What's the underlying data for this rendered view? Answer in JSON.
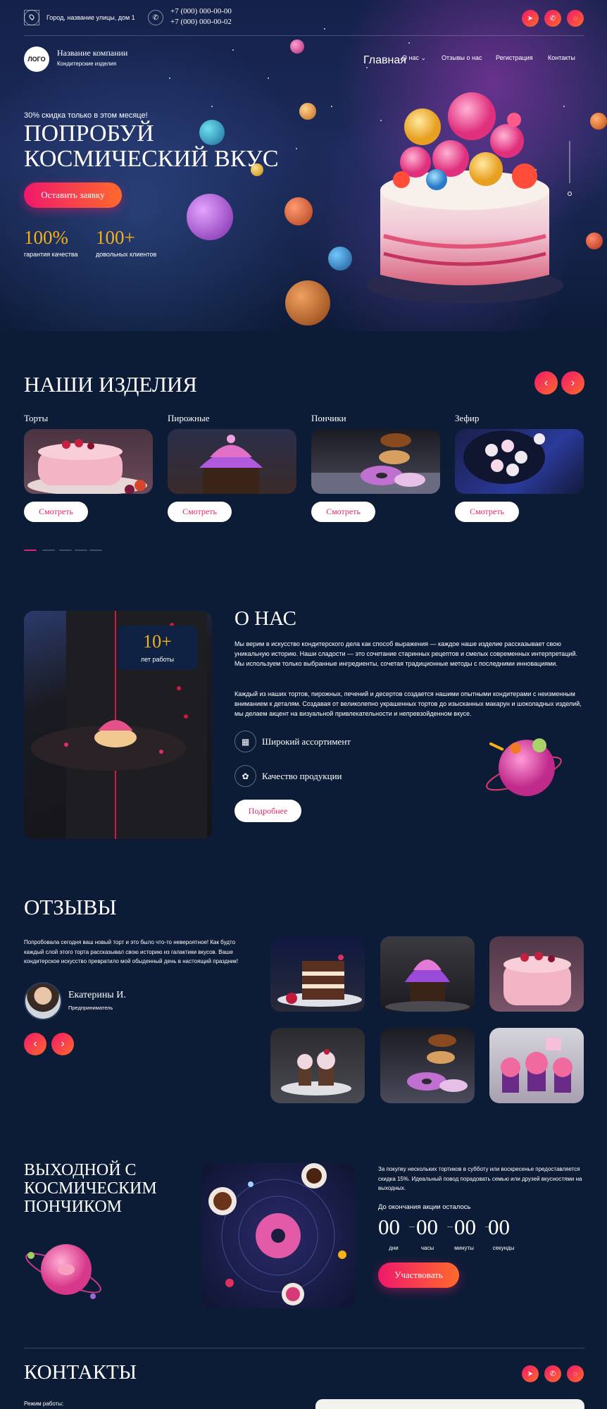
{
  "topbar": {
    "address": "Город, название улицы, дом 1",
    "phone1": "+7 (000) 000-00-00",
    "phone2": "+7 (000) 000-00-02",
    "social_icons": [
      "telegram-icon",
      "viber-icon",
      "whatsapp-icon"
    ]
  },
  "header": {
    "logo": "ЛОГО",
    "company_name": "Название компании",
    "company_sub": "Кондитерские изделия",
    "nav": [
      "Главная",
      "О нас",
      "Отзывы о нас",
      "Регистрация",
      "Контакты"
    ]
  },
  "hero": {
    "promo": "30% скидка только в этом месяце!",
    "title_line1": "ПОПРОБУЙ",
    "title_line2": "КОСМИЧЕСКИЙ ВКУС",
    "cta": "Оставить заявку",
    "stat1_value": "100%",
    "stat1_label": "гарантия качества",
    "stat2_value": "100+",
    "stat2_label": "довольных клиентов"
  },
  "products": {
    "title": "НАШИ ИЗДЕЛИЯ",
    "view_label": "Смотреть",
    "items": [
      {
        "name": "Торты"
      },
      {
        "name": "Пирожные"
      },
      {
        "name": "Пончики"
      },
      {
        "name": "Зефир"
      }
    ]
  },
  "about": {
    "title": "О НАС",
    "years_value": "10+",
    "years_label": "лет работы",
    "p1": "Мы верим в искусство кондитерского дела как способ выражения — каждое наше изделие рассказывает свою уникальную историю. Наши сладости — это сочетание старинных рецептов и смелых современных интерпретаций. Мы используем только выбранные ингредиенты, сочетая традиционные методы с последними инновациями.",
    "p2": "Каждый из наших тортов, пирожных, печений и десертов создается нашими опытными кондитерами с неизменным вниманием к деталям. Создавая от великолепно украшенных тортов до изысканных макарун и шоколадных изделий, мы делаем акцент на визуальной привлекательности и непревзойденном вкусе.",
    "feature1": "Широкий ассортимент",
    "feature2": "Качество продукции",
    "more": "Подробнее"
  },
  "reviews": {
    "title": "ОТЗЫВЫ",
    "text": "Попробовала сегодня ваш новый торт  и это было что-то невероятное! Как будто каждый слой этого торта рассказывал свою историю из галактики вкусов.  Ваше кондитерское искусство превратило мой обыденный день в настоящий праздник!",
    "author": "Екатерины И.",
    "role": "Предприниматель"
  },
  "promo": {
    "title_line1": "ВЫХОДНОЙ С",
    "title_line2": "КОСМИЧЕСКИМ",
    "title_line3": "ПОНЧИКОМ",
    "text": "За покупку нескольких тортиков в субботу или воскресенье предоставляется скидка 15%. Идеальный повод порадовать семью или друзей вкусностями на выходных.",
    "countdown_label": "До окончания акции осталось",
    "days": "00",
    "hours": "00",
    "minutes": "00",
    "seconds": "00",
    "days_label": "дни",
    "hours_label": "часы",
    "minutes_label": "минуты",
    "seconds_label": "секунды",
    "cta": "Участвовать"
  },
  "contacts": {
    "title": "КОНТАКТЫ",
    "hours_label": "Режим работы:"
  },
  "colors": {
    "bg": "#0c1c36",
    "accent_pink": "#f0186b",
    "accent_orange": "#ff6a2c",
    "gold": "#f5b11a"
  }
}
